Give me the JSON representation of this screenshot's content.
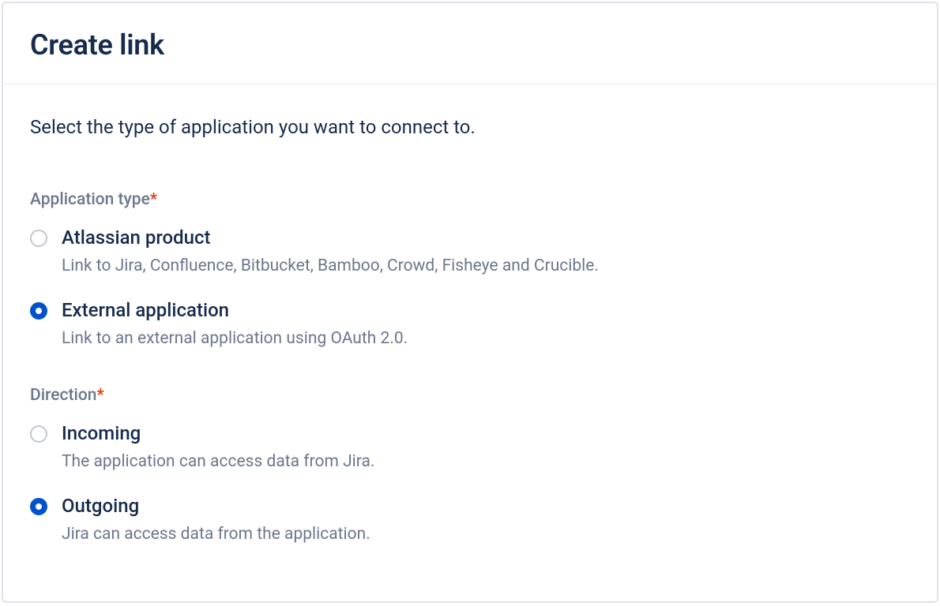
{
  "modal": {
    "title": "Create link",
    "instruction": "Select the type of application you want to connect to."
  },
  "fields": {
    "applicationType": {
      "label": "Application type",
      "required": true,
      "options": [
        {
          "title": "Atlassian product",
          "description": "Link to Jira, Confluence, Bitbucket, Bamboo, Crowd, Fisheye and Crucible.",
          "selected": false
        },
        {
          "title": "External application",
          "description": "Link to an external application using OAuth 2.0.",
          "selected": true
        }
      ]
    },
    "direction": {
      "label": "Direction",
      "required": true,
      "options": [
        {
          "title": "Incoming",
          "description": "The application can access data from Jira.",
          "selected": false
        },
        {
          "title": "Outgoing",
          "description": "Jira can access data from the application.",
          "selected": true
        }
      ]
    }
  }
}
